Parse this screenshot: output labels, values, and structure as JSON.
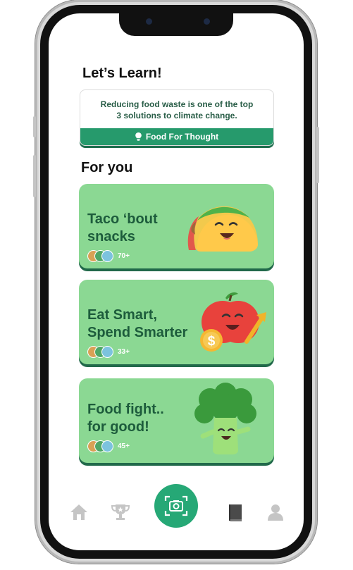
{
  "learn": {
    "title": "Let’s Learn!",
    "fact_line1": "Reducing food waste is one of the top",
    "fact_line2": "3 solutions to climate change.",
    "footer_label": "Food For Thought"
  },
  "for_you": {
    "title": "For you",
    "cards": [
      {
        "title_line1": "Taco ‘bout",
        "title_line2": "snacks",
        "count": "70+",
        "illustration": "taco-icon"
      },
      {
        "title_line1": "Eat Smart,",
        "title_line2": "Spend Smarter",
        "count": "33+",
        "illustration": "apple-money-icon"
      },
      {
        "title_line1": "Food fight..",
        "title_line2": "for good!",
        "count": "45+",
        "illustration": "broccoli-icon"
      }
    ]
  },
  "nav": {
    "items": [
      "home-icon",
      "trophy-icon",
      "camera-scan-icon",
      "book-icon",
      "profile-icon"
    ]
  },
  "colors": {
    "accent": "#269a6c",
    "card_bg": "#8bd893",
    "card_title": "#1d5c3c"
  }
}
